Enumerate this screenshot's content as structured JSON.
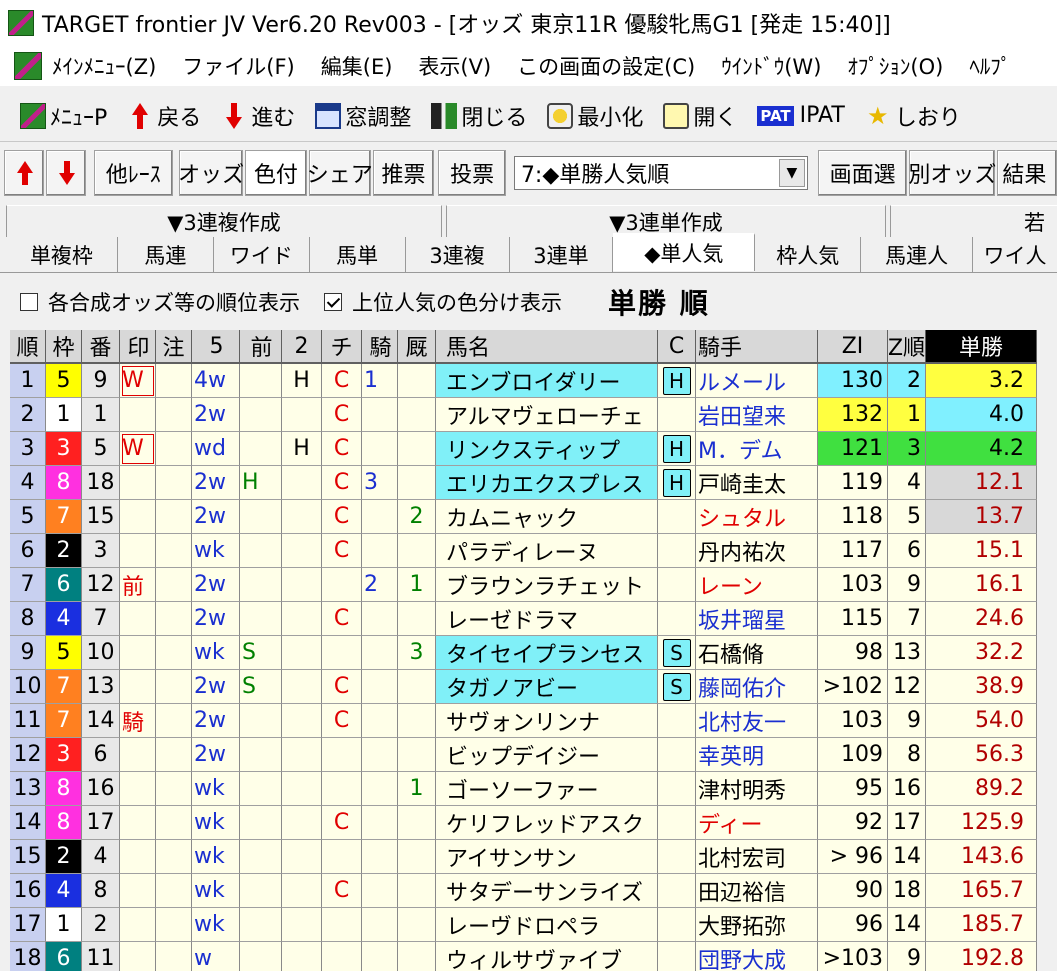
{
  "title": "TARGET frontier JV  Ver6.20  Rev003 - [オッズ 東京11R 優駿牝馬G1  [発走 15:40]]",
  "menu": [
    "ﾒｲﾝﾒﾆｭｰ(Z)",
    "ファイル(F)",
    "編集(E)",
    "表示(V)",
    "この画面の設定(C)",
    "ｳｲﾝﾄﾞｳ(W)",
    "ｵﾌﾟｼｮﾝ(O)",
    "ﾍﾙﾌﾟ"
  ],
  "toolbar1": [
    {
      "icon": "menu-icon",
      "label": "ﾒﾆｭｰP"
    },
    {
      "icon": "back-arrow-icon",
      "label": "戻る"
    },
    {
      "icon": "forward-arrow-icon",
      "label": "進む"
    },
    {
      "icon": "window-adjust-icon",
      "label": "窓調整"
    },
    {
      "icon": "close-door-icon",
      "label": "閉じる"
    },
    {
      "icon": "minimize-icon",
      "label": "最小化"
    },
    {
      "icon": "open-icon",
      "label": "開く"
    },
    {
      "icon": "ipat-icon",
      "badge": "PAT",
      "label": "IPAT"
    },
    {
      "icon": "bookmark-star-icon",
      "label": "しおり"
    }
  ],
  "toolbar2": {
    "buttons_left": [
      "他ﾚｰｽ",
      "オッズ",
      "色付",
      "シェア",
      "推票",
      "投票"
    ],
    "sort_select": "7:◆単勝人気順",
    "buttons_right": [
      "画面選",
      "別オッズ",
      "結果"
    ]
  },
  "tab_groups": [
    {
      "label": "▼3連複作成"
    },
    {
      "label": "▼3連単作成"
    },
    {
      "label": "若"
    }
  ],
  "tabs": [
    "単複枠",
    "馬連",
    "ワイド",
    "馬単",
    "3連複",
    "3連単",
    "◆単人気",
    "枠人気",
    "馬連人",
    "ワイ人"
  ],
  "options": {
    "opt1": "各合成オッズ等の順位表示",
    "opt2": "上位人気の色分け表示",
    "section_title": "単勝 順"
  },
  "columns": [
    "順",
    "枠",
    "番",
    "印",
    "注",
    "5",
    "前",
    "2",
    "チ",
    "騎",
    "厩",
    "馬名",
    "C",
    "騎手",
    "ZI",
    "Z順",
    "単勝"
  ],
  "colors": {
    "waku1": "#ffffff",
    "waku2": "#000000",
    "waku3": "#ff2020",
    "waku4": "#1a2fe0",
    "waku5": "#ffff00",
    "waku6": "#008080",
    "waku7": "#ff8020",
    "waku8": "#ff30e0",
    "highlight_cyan": "#80f0f8",
    "zi_yellow": "#ffff40",
    "zi_cyan": "#80f0ff",
    "zi_green": "#40e040",
    "odds_gray": "#d8d8d8"
  },
  "rows": [
    {
      "juni": "1",
      "waku": "5",
      "ban": "9",
      "shirushi": "W",
      "chu": "",
      "five": "4w",
      "mae": "",
      "ni": "H",
      "chi": "C",
      "ki": "1",
      "kyu": "",
      "name": "エンブロイダリー",
      "c": "H",
      "jockey": "ルメール",
      "zi": "130",
      "zjun": "2",
      "odds": "3.2"
    },
    {
      "juni": "2",
      "waku": "1",
      "ban": "1",
      "shirushi": "",
      "chu": "",
      "five": "2w",
      "mae": "",
      "ni": "",
      "chi": "C",
      "ki": "",
      "kyu": "",
      "name": "アルマヴェローチェ",
      "c": "",
      "jockey": "岩田望来",
      "zi": "132",
      "zjun": "1",
      "odds": "4.0"
    },
    {
      "juni": "3",
      "waku": "3",
      "ban": "5",
      "shirushi": "W",
      "chu": "",
      "five": "wd",
      "mae": "",
      "ni": "H",
      "chi": "C",
      "ki": "",
      "kyu": "",
      "name": "リンクスティップ",
      "c": "H",
      "jockey": "M．デム",
      "zi": "121",
      "zjun": "3",
      "odds": "4.2"
    },
    {
      "juni": "4",
      "waku": "8",
      "ban": "18",
      "shirushi": "",
      "chu": "",
      "five": "2w",
      "mae": "H",
      "ni": "",
      "chi": "C",
      "ki": "3",
      "kyu": "",
      "name": "エリカエクスプレス",
      "c": "H",
      "jockey": "戸崎圭太",
      "zi": "119",
      "zjun": "4",
      "odds": "12.1"
    },
    {
      "juni": "5",
      "waku": "7",
      "ban": "15",
      "shirushi": "",
      "chu": "",
      "five": "2w",
      "mae": "",
      "ni": "",
      "chi": "C",
      "ki": "",
      "kyu": "2",
      "name": "カムニャック",
      "c": "",
      "jockey": "シュタル",
      "zi": "118",
      "zjun": "5",
      "odds": "13.7"
    },
    {
      "juni": "6",
      "waku": "2",
      "ban": "3",
      "shirushi": "",
      "chu": "",
      "five": "wk",
      "mae": "",
      "ni": "",
      "chi": "C",
      "ki": "",
      "kyu": "",
      "name": "パラディレーヌ",
      "c": "",
      "jockey": "丹内祐次",
      "zi": "117",
      "zjun": "6",
      "odds": "15.1"
    },
    {
      "juni": "7",
      "waku": "6",
      "ban": "12",
      "shirushi": "前",
      "chu": "",
      "five": "2w",
      "mae": "",
      "ni": "",
      "chi": "",
      "ki": "2",
      "kyu": "1",
      "name": "ブラウンラチェット",
      "c": "",
      "jockey": "レーン",
      "zi": "103",
      "zjun": "9",
      "odds": "16.1"
    },
    {
      "juni": "8",
      "waku": "4",
      "ban": "7",
      "shirushi": "",
      "chu": "",
      "five": "2w",
      "mae": "",
      "ni": "",
      "chi": "C",
      "ki": "",
      "kyu": "",
      "name": "レーゼドラマ",
      "c": "",
      "jockey": "坂井瑠星",
      "zi": "115",
      "zjun": "7",
      "odds": "24.6"
    },
    {
      "juni": "9",
      "waku": "5",
      "ban": "10",
      "shirushi": "",
      "chu": "",
      "five": "wk",
      "mae": "S",
      "ni": "",
      "chi": "",
      "ki": "",
      "kyu": "3",
      "name": "タイセイプランセス",
      "c": "S",
      "jockey": "石橋脩",
      "zi": "98",
      "zjun": "13",
      "odds": "32.2"
    },
    {
      "juni": "10",
      "waku": "7",
      "ban": "13",
      "shirushi": "",
      "chu": "",
      "five": "2w",
      "mae": "S",
      "ni": "",
      "chi": "C",
      "ki": "",
      "kyu": "",
      "name": "タガノアビー",
      "c": "S",
      "jockey": "藤岡佑介",
      "zi": ">102",
      "zjun": "12",
      "odds": "38.9"
    },
    {
      "juni": "11",
      "waku": "7",
      "ban": "14",
      "shirushi": "騎",
      "chu": "",
      "five": "2w",
      "mae": "",
      "ni": "",
      "chi": "C",
      "ki": "",
      "kyu": "",
      "name": "サヴォンリンナ",
      "c": "",
      "jockey": "北村友一",
      "zi": "103",
      "zjun": "9",
      "odds": "54.0"
    },
    {
      "juni": "12",
      "waku": "3",
      "ban": "6",
      "shirushi": "",
      "chu": "",
      "five": "2w",
      "mae": "",
      "ni": "",
      "chi": "",
      "ki": "",
      "kyu": "",
      "name": "ビップデイジー",
      "c": "",
      "jockey": "幸英明",
      "zi": "109",
      "zjun": "8",
      "odds": "56.3"
    },
    {
      "juni": "13",
      "waku": "8",
      "ban": "16",
      "shirushi": "",
      "chu": "",
      "five": "wk",
      "mae": "",
      "ni": "",
      "chi": "",
      "ki": "",
      "kyu": "1",
      "name": "ゴーソーファー",
      "c": "",
      "jockey": "津村明秀",
      "zi": "95",
      "zjun": "16",
      "odds": "89.2"
    },
    {
      "juni": "14",
      "waku": "8",
      "ban": "17",
      "shirushi": "",
      "chu": "",
      "five": "wk",
      "mae": "",
      "ni": "",
      "chi": "C",
      "ki": "",
      "kyu": "",
      "name": "ケリフレッドアスク",
      "c": "",
      "jockey": "ディー",
      "zi": "92",
      "zjun": "17",
      "odds": "125.9"
    },
    {
      "juni": "15",
      "waku": "2",
      "ban": "4",
      "shirushi": "",
      "chu": "",
      "five": "wk",
      "mae": "",
      "ni": "",
      "chi": "",
      "ki": "",
      "kyu": "",
      "name": "アイサンサン",
      "c": "",
      "jockey": "北村宏司",
      "zi": "> 96",
      "zjun": "14",
      "odds": "143.6"
    },
    {
      "juni": "16",
      "waku": "4",
      "ban": "8",
      "shirushi": "",
      "chu": "",
      "five": "wk",
      "mae": "",
      "ni": "",
      "chi": "C",
      "ki": "",
      "kyu": "",
      "name": "サタデーサンライズ",
      "c": "",
      "jockey": "田辺裕信",
      "zi": "90",
      "zjun": "18",
      "odds": "165.7"
    },
    {
      "juni": "17",
      "waku": "1",
      "ban": "2",
      "shirushi": "",
      "chu": "",
      "five": "wk",
      "mae": "",
      "ni": "",
      "chi": "",
      "ki": "",
      "kyu": "",
      "name": "レーヴドロペラ",
      "c": "",
      "jockey": "大野拓弥",
      "zi": "96",
      "zjun": "14",
      "odds": "185.7"
    },
    {
      "juni": "18",
      "waku": "6",
      "ban": "11",
      "shirushi": "",
      "chu": "",
      "five": "w",
      "mae": "",
      "ni": "",
      "chi": "",
      "ki": "",
      "kyu": "",
      "name": "ウィルサヴァイブ",
      "c": "",
      "jockey": "団野大成",
      "zi": ">103",
      "zjun": "9",
      "odds": "192.8"
    }
  ]
}
